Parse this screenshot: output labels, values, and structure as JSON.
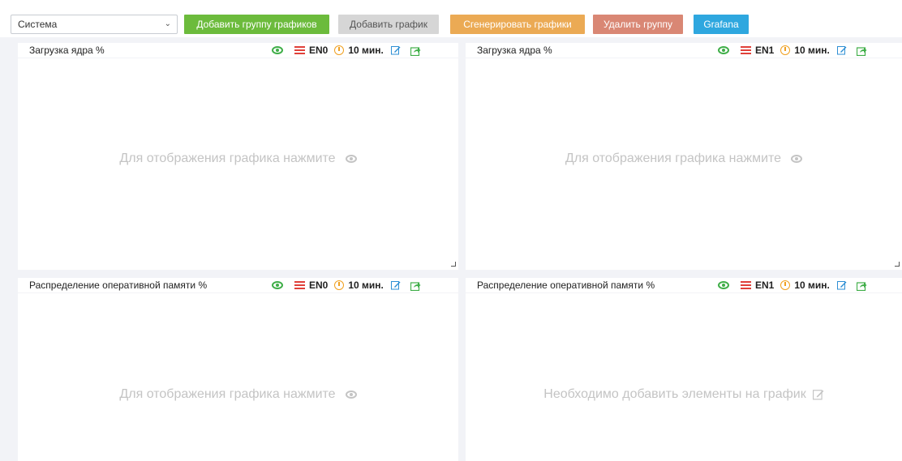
{
  "toolbar": {
    "group_select": {
      "value": "Система"
    },
    "add_group_label": "Добавить группу графиков",
    "add_chart_label": "Добавить график",
    "generate_label": "Сгенерировать графики",
    "delete_group_label": "Удалить группу",
    "grafana_label": "Grafana"
  },
  "panels": [
    {
      "title": "Загрузка ядра %",
      "node": "EN0",
      "interval": "10 мин.",
      "placeholder": "Для отображения графика нажмите"
    },
    {
      "title": "Загрузка ядра %",
      "node": "EN1",
      "interval": "10 мин.",
      "placeholder": "Для отображения графика нажмите"
    },
    {
      "title": "Распределение оперативной памяти %",
      "node": "EN0",
      "interval": "10 мин.",
      "placeholder": "Для отображения графика нажмите"
    },
    {
      "title": "Распределение оперативной памяти %",
      "node": "EN1",
      "interval": "10 мин.",
      "placeholder": "Необходимо добавить элементы на график"
    }
  ],
  "colors": {
    "add_group": "#6cbb3c",
    "add_chart": "#d6d6d6",
    "generate": "#ebaa54",
    "delete_group": "#d98774",
    "grafana": "#2ea7df",
    "eye_icon": "#3fae48",
    "server_icon": "#e0403a",
    "clock_icon": "#f0a020"
  }
}
